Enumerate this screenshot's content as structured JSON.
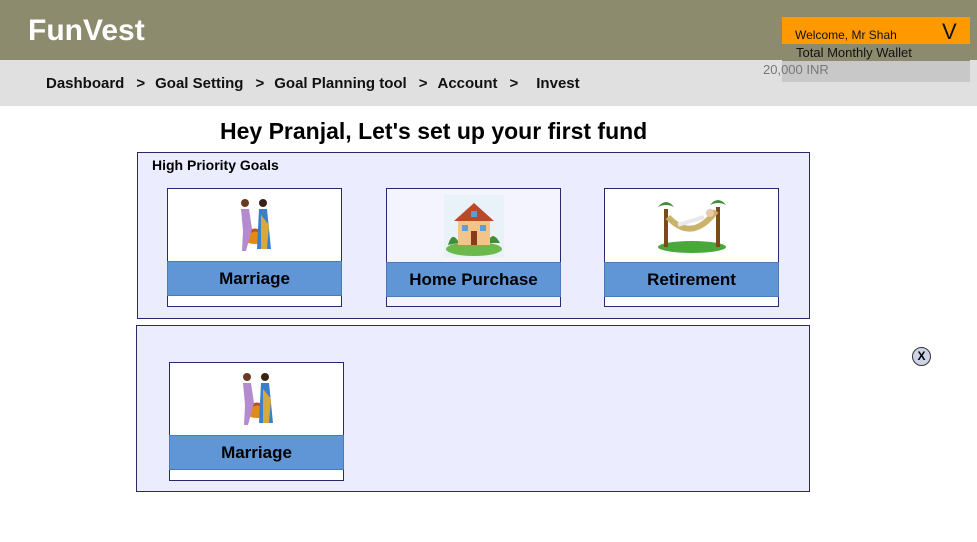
{
  "app": {
    "brand": "FunVest"
  },
  "breadcrumb": [
    "Dashboard",
    "Goal Setting",
    "Goal Planning tool",
    "Account",
    "Invest"
  ],
  "breadcrumb_separator": ">",
  "user": {
    "welcome": "Welcome,  Mr Shah",
    "toggle": "V",
    "wallet_label": "Total Monthly Wallet",
    "wallet_value": "20,000 INR"
  },
  "headline": "Hey Pranjal, Let's set up your first fund",
  "high_priority": {
    "title": "High Priority Goals",
    "cards": [
      {
        "label": "Marriage",
        "icon": "marriage-icon"
      },
      {
        "label": "Home Purchase",
        "icon": "house-icon"
      },
      {
        "label": "Retirement",
        "icon": "hammock-icon"
      }
    ]
  },
  "selected": {
    "cards": [
      {
        "label": "Marriage",
        "icon": "marriage-icon"
      }
    ]
  },
  "close_label": "X",
  "colors": {
    "header": "#8c8b6d",
    "nav": "#e0e0e0",
    "accent_orange": "#ff9900",
    "panel_bg": "#ececff",
    "card_label_bg": "#6096d6"
  }
}
